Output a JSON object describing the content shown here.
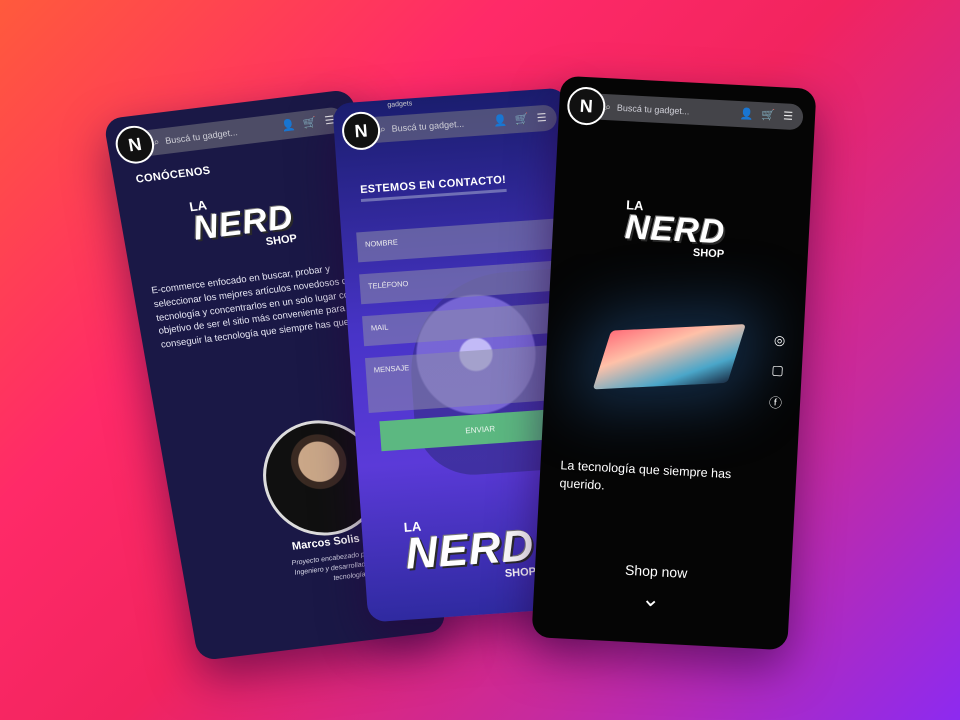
{
  "about_phone": {
    "search_placeholder": "Buscá tu gadget...",
    "section_title": "CONÓCENOS",
    "brand": {
      "la": "LA",
      "nerd": "NERD",
      "shop": "SHOP"
    },
    "description": "E-commerce enfocado en buscar, probar y seleccionar los mejores artículos novedosos de tecnología y concentrarlos en un solo lugar con el objetivo de ser el sitio más conveniente para conseguir la tecnología que siempre has querido.",
    "person_name": "Marcos Solis",
    "caption": "Proyecto encabezado por Marcos Santiago, Ingeniero y desarrollador apasionado por la tecnología, la ciencia y gadgets"
  },
  "contact_phone": {
    "top_text": "gadgets",
    "search_placeholder": "Buscá tu gadget...",
    "section_title": "ESTEMOS EN CONTACTO!",
    "fields": [
      "NOMBRE",
      "TELÉFONO",
      "MAIL",
      "MENSAJE"
    ],
    "send_label": "ENVIAR",
    "brand": {
      "la": "LA",
      "nerd": "NERD",
      "shop": "SHOP"
    }
  },
  "home_phone": {
    "search_placeholder": "Buscá tu gadget...",
    "brand": {
      "la": "LA",
      "nerd": "NERD",
      "shop": "SHOP"
    },
    "tagline": "La tecnología que siempre has querido.",
    "shop_now": "Shop now",
    "social_icons": [
      "whatsapp-icon",
      "instagram-icon",
      "facebook-icon"
    ]
  },
  "colors": {
    "background_start": "#ff5a3c",
    "background_end": "#8d2af0",
    "send_button": "#5cb881"
  }
}
